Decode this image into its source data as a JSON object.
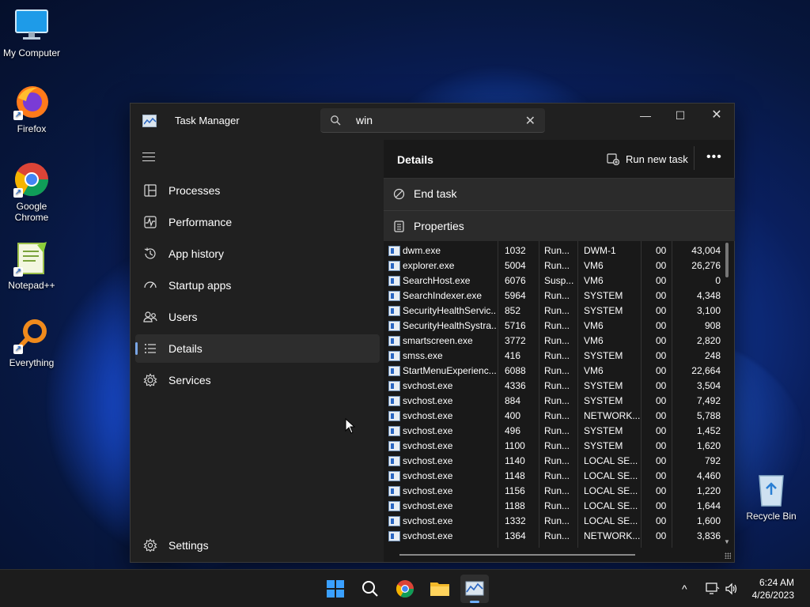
{
  "desktop": {
    "icons": [
      {
        "label": "My Computer"
      },
      {
        "label": "Firefox"
      },
      {
        "label": "Google Chrome"
      },
      {
        "label": "Notepad++"
      },
      {
        "label": "Everything"
      }
    ],
    "recycle_bin": "Recycle Bin"
  },
  "window": {
    "title": "Task Manager",
    "search_value": "win",
    "clear_glyph": "✕",
    "minimize": "—",
    "maximize": "☐",
    "close": "✕"
  },
  "sidebar": {
    "items": [
      {
        "label": "Processes",
        "icon": "processes-icon"
      },
      {
        "label": "Performance",
        "icon": "performance-icon"
      },
      {
        "label": "App history",
        "icon": "app-history-icon"
      },
      {
        "label": "Startup apps",
        "icon": "startup-apps-icon"
      },
      {
        "label": "Users",
        "icon": "users-icon"
      },
      {
        "label": "Details",
        "icon": "details-icon",
        "active": true
      },
      {
        "label": "Services",
        "icon": "services-icon"
      }
    ],
    "settings": "Settings"
  },
  "details": {
    "title": "Details",
    "run_new_task": "Run new task",
    "more": "•••",
    "context_menu": {
      "end_task": "End task",
      "properties": "Properties"
    },
    "rows": [
      {
        "name": "dwm.exe",
        "pid": "1032",
        "status": "Run...",
        "user": "DWM-1",
        "cpu": "00",
        "mem": "43,004"
      },
      {
        "name": "explorer.exe",
        "pid": "5004",
        "status": "Run...",
        "user": "VM6",
        "cpu": "00",
        "mem": "26,276"
      },
      {
        "name": "SearchHost.exe",
        "pid": "6076",
        "status": "Susp...",
        "user": "VM6",
        "cpu": "00",
        "mem": "0"
      },
      {
        "name": "SearchIndexer.exe",
        "pid": "5964",
        "status": "Run...",
        "user": "SYSTEM",
        "cpu": "00",
        "mem": "4,348"
      },
      {
        "name": "SecurityHealthServic...",
        "pid": "852",
        "status": "Run...",
        "user": "SYSTEM",
        "cpu": "00",
        "mem": "3,100"
      },
      {
        "name": "SecurityHealthSystra...",
        "pid": "5716",
        "status": "Run...",
        "user": "VM6",
        "cpu": "00",
        "mem": "908"
      },
      {
        "name": "smartscreen.exe",
        "pid": "3772",
        "status": "Run...",
        "user": "VM6",
        "cpu": "00",
        "mem": "2,820"
      },
      {
        "name": "smss.exe",
        "pid": "416",
        "status": "Run...",
        "user": "SYSTEM",
        "cpu": "00",
        "mem": "248"
      },
      {
        "name": "StartMenuExperienc...",
        "pid": "6088",
        "status": "Run...",
        "user": "VM6",
        "cpu": "00",
        "mem": "22,664"
      },
      {
        "name": "svchost.exe",
        "pid": "4336",
        "status": "Run...",
        "user": "SYSTEM",
        "cpu": "00",
        "mem": "3,504"
      },
      {
        "name": "svchost.exe",
        "pid": "884",
        "status": "Run...",
        "user": "SYSTEM",
        "cpu": "00",
        "mem": "7,492"
      },
      {
        "name": "svchost.exe",
        "pid": "400",
        "status": "Run...",
        "user": "NETWORK...",
        "cpu": "00",
        "mem": "5,788"
      },
      {
        "name": "svchost.exe",
        "pid": "496",
        "status": "Run...",
        "user": "SYSTEM",
        "cpu": "00",
        "mem": "1,452"
      },
      {
        "name": "svchost.exe",
        "pid": "1100",
        "status": "Run...",
        "user": "SYSTEM",
        "cpu": "00",
        "mem": "1,620"
      },
      {
        "name": "svchost.exe",
        "pid": "1140",
        "status": "Run...",
        "user": "LOCAL SE...",
        "cpu": "00",
        "mem": "792"
      },
      {
        "name": "svchost.exe",
        "pid": "1148",
        "status": "Run...",
        "user": "LOCAL SE...",
        "cpu": "00",
        "mem": "4,460"
      },
      {
        "name": "svchost.exe",
        "pid": "1156",
        "status": "Run...",
        "user": "LOCAL SE...",
        "cpu": "00",
        "mem": "1,220"
      },
      {
        "name": "svchost.exe",
        "pid": "1188",
        "status": "Run...",
        "user": "LOCAL SE...",
        "cpu": "00",
        "mem": "1,644"
      },
      {
        "name": "svchost.exe",
        "pid": "1332",
        "status": "Run...",
        "user": "LOCAL SE...",
        "cpu": "00",
        "mem": "1,600"
      },
      {
        "name": "svchost.exe",
        "pid": "1364",
        "status": "Run...",
        "user": "NETWORK...",
        "cpu": "00",
        "mem": "3,836"
      }
    ]
  },
  "taskbar": {
    "time": "6:24 AM",
    "date": "4/26/2023",
    "tray_chevron": "^"
  }
}
